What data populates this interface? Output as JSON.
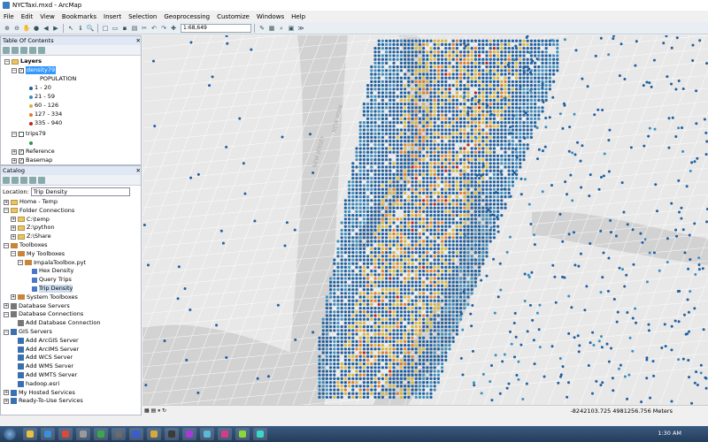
{
  "window": {
    "title": "NYCTaxi.mxd - ArcMap"
  },
  "menu": [
    "File",
    "Edit",
    "View",
    "Bookmarks",
    "Insert",
    "Selection",
    "Geoprocessing",
    "Customize",
    "Windows",
    "Help"
  ],
  "toolbar": {
    "scale": "1:68,649"
  },
  "toc": {
    "title": "Table Of Contents",
    "root": "Layers",
    "layer1": "density79",
    "legend_title": "POPULATION",
    "classes": [
      {
        "label": "1 - 20",
        "color": "#1f5fa0"
      },
      {
        "label": "21 - 59",
        "color": "#3a8fc0"
      },
      {
        "label": "60 - 126",
        "color": "#d4b43a"
      },
      {
        "label": "127 - 334",
        "color": "#e07b2a"
      },
      {
        "label": "335 - 940",
        "color": "#c0221a"
      }
    ],
    "layer2": "trips79",
    "layer3": "Reference",
    "layer4": "Basemap"
  },
  "catalog": {
    "title": "Catalog",
    "location_label": "Location:",
    "location_value": "Trip Density",
    "items": [
      "Home - Temp",
      "Folder Connections",
      "C:\\temp",
      "Z:\\python",
      "Z:\\Share",
      "Toolboxes",
      "My Toolboxes",
      "ImpalaToolbox.pyt",
      "Hex Density",
      "Query Trips",
      "Trip Density",
      "System Toolboxes",
      "Database Servers",
      "Database Connections",
      "Add Database Connection",
      "GIS Servers",
      "Add ArcGIS Server",
      "Add ArcIMS Server",
      "Add WCS Server",
      "Add WMS Server",
      "Add WMTS Server",
      "hadoop.esri",
      "My Hosted Services",
      "Ready-To-Use Services"
    ]
  },
  "map": {
    "labels": [
      "NEW JERSEY",
      "NEW YORK"
    ]
  },
  "status": {
    "coords": "-8242103.725  4981256.756 Meters"
  },
  "taskbar": {
    "clock": "1:30 AM"
  }
}
